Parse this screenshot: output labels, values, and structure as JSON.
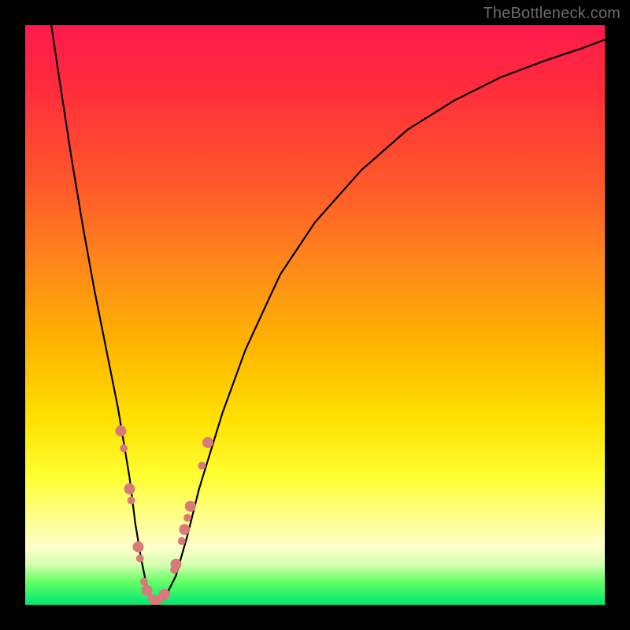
{
  "watermark": "TheBottleneck.com",
  "chart_data": {
    "type": "line",
    "title": "",
    "xlabel": "",
    "ylabel": "",
    "xlim": [
      0,
      100
    ],
    "ylim": [
      0,
      100
    ],
    "series": [
      {
        "name": "bottleneck-curve",
        "x": [
          4.5,
          6,
          8,
          10,
          12,
          14,
          16,
          17,
          18,
          19,
          20,
          21,
          22,
          23,
          24,
          26,
          28,
          30,
          34,
          38,
          44,
          50,
          58,
          66,
          74,
          82,
          90,
          96,
          100
        ],
        "values": [
          100,
          90,
          77,
          65,
          54,
          44,
          34,
          28,
          22,
          14,
          8,
          3,
          1,
          0.5,
          1,
          5,
          12,
          20,
          33,
          44,
          57,
          66,
          75,
          82,
          87,
          91,
          94,
          96,
          97.5
        ],
        "color": "#000000"
      }
    ],
    "markers": {
      "name": "highlight-points",
      "color": "#d97a7a",
      "radius_small": 5,
      "radius_large": 7,
      "points": [
        {
          "x": 16.5,
          "y": 30,
          "r": "large"
        },
        {
          "x": 17.0,
          "y": 27,
          "r": "small"
        },
        {
          "x": 18.0,
          "y": 20,
          "r": "large"
        },
        {
          "x": 18.3,
          "y": 18,
          "r": "small"
        },
        {
          "x": 19.5,
          "y": 10,
          "r": "large"
        },
        {
          "x": 19.8,
          "y": 8,
          "r": "small"
        },
        {
          "x": 20.5,
          "y": 4,
          "r": "small"
        },
        {
          "x": 21.0,
          "y": 2.5,
          "r": "large"
        },
        {
          "x": 21.8,
          "y": 1.2,
          "r": "small"
        },
        {
          "x": 22.5,
          "y": 0.7,
          "r": "large"
        },
        {
          "x": 23.3,
          "y": 1.0,
          "r": "small"
        },
        {
          "x": 24.0,
          "y": 1.8,
          "r": "large"
        },
        {
          "x": 25.7,
          "y": 6,
          "r": "small"
        },
        {
          "x": 26.0,
          "y": 7,
          "r": "large"
        },
        {
          "x": 27.0,
          "y": 11,
          "r": "small"
        },
        {
          "x": 27.5,
          "y": 13,
          "r": "large"
        },
        {
          "x": 28.0,
          "y": 15,
          "r": "small"
        },
        {
          "x": 28.5,
          "y": 17,
          "r": "large"
        },
        {
          "x": 30.5,
          "y": 24,
          "r": "small"
        },
        {
          "x": 31.5,
          "y": 28,
          "r": "large"
        }
      ]
    }
  }
}
